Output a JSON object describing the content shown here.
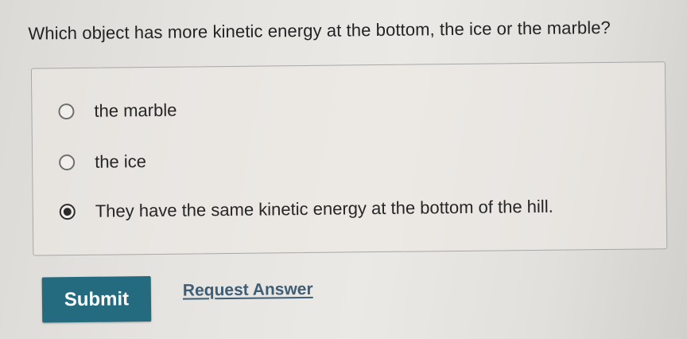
{
  "question": {
    "text": "Which object has more kinetic energy at the bottom, the ice or the marble?"
  },
  "options": [
    {
      "label": "the marble",
      "selected": false
    },
    {
      "label": "the ice",
      "selected": false
    },
    {
      "label": "They have the same kinetic energy at the bottom of the hill.",
      "selected": true
    }
  ],
  "actions": {
    "submit_label": "Submit",
    "request_answer_label": "Request Answer"
  },
  "colors": {
    "submit_background": "#256b7f",
    "link": "#3f5e75"
  }
}
